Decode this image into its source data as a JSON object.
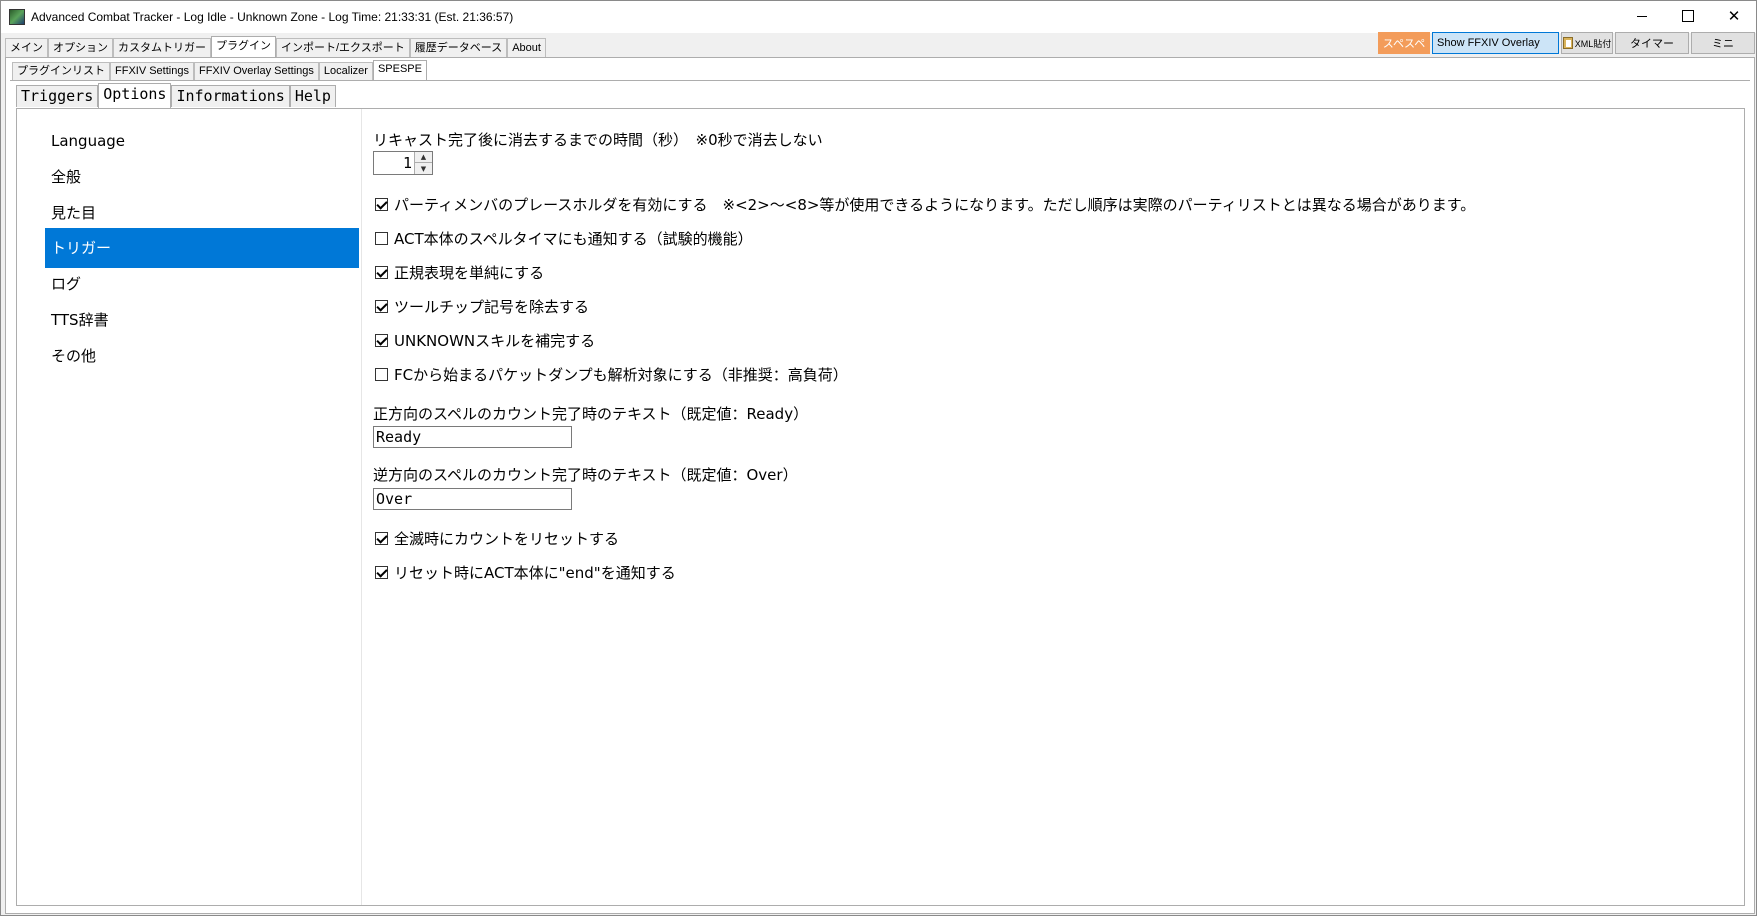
{
  "window": {
    "title": "Advanced Combat Tracker - Log Idle - Unknown Zone - Log Time: 21:33:31 (Est. 21:36:57)",
    "controls": {
      "minimize": "",
      "maximize": "",
      "close": "✕"
    }
  },
  "main_tabs": [
    "メイン",
    "オプション",
    "カスタムトリガー",
    "プラグイン",
    "インポート/エクスポート",
    "履歴データベース",
    "About"
  ],
  "toolbar": {
    "spespe": "スペスペ",
    "overlay": "Show FFXIV Overlay",
    "xml": "XML貼付",
    "timer": "タイマー",
    "mini": "ミニ",
    "accent_color": "#f39c5a",
    "overlay_color": "#cce4f7"
  },
  "plugin_tabs": [
    "プラグインリスト",
    "FFXIV Settings",
    "FFXIV Overlay Settings",
    "Localizer",
    "SPESPE"
  ],
  "spespe_tabs": [
    "Triggers",
    "Options",
    "Informations",
    "Help"
  ],
  "sidebar": {
    "items": [
      "Language",
      "全般",
      "見た目",
      "トリガー",
      "ログ",
      "TTS辞書",
      "その他"
    ],
    "selected": "トリガー",
    "selected_color": "#0078d7"
  },
  "options": {
    "recast_label": "リキャスト完了後に消去するまでの時間（秒）　※0秒で消去しない",
    "recast_value": "1",
    "checks": [
      {
        "label": "パーティメンバのプレースホルダを有効にする　※<2>〜<8>等が使用できるようになります。ただし順序は実際のパーティリストとは異なる場合があります。",
        "checked": true
      },
      {
        "label": "ACT本体のスペルタイマにも通知する（試験的機能）",
        "checked": false
      },
      {
        "label": "正規表現を単純にする",
        "checked": true
      },
      {
        "label": "ツールチップ記号を除去する",
        "checked": true
      },
      {
        "label": "UNKNOWNスキルを補完する",
        "checked": true
      },
      {
        "label": "FCから始まるパケットダンプも解析対象にする（非推奨：高負荷）",
        "checked": false
      }
    ],
    "ready_label": "正方向のスペルのカウント完了時のテキスト（既定値：Ready）",
    "ready_value": "Ready",
    "over_label": "逆方向のスペルのカウント完了時のテキスト（既定値：Over）",
    "over_value": "Over",
    "checks2": [
      {
        "label": "全滅時にカウントをリセットする",
        "checked": true
      },
      {
        "label": "リセット時にACT本体に\"end\"を通知する",
        "checked": true
      }
    ]
  }
}
